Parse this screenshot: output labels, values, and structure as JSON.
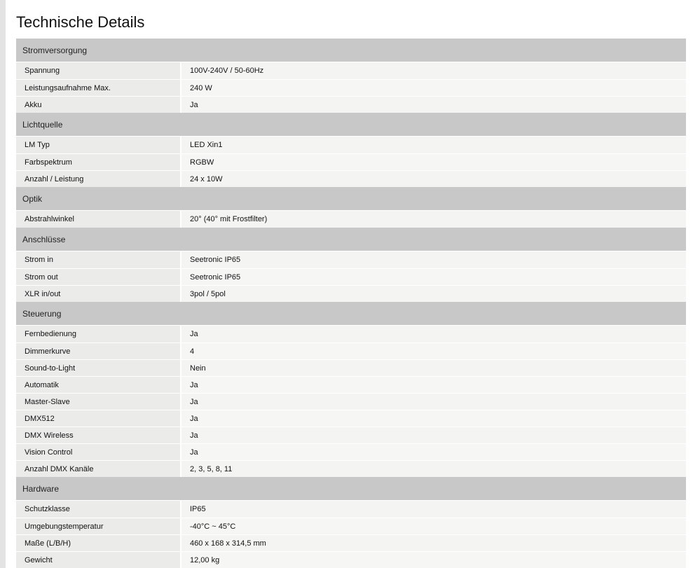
{
  "page": {
    "title": "Technische Details"
  },
  "sections": [
    {
      "header": "Stromversorgung",
      "rows": [
        {
          "label": "Spannung",
          "value": "100V-240V / 50-60Hz"
        },
        {
          "label": "Leistungsaufnahme Max.",
          "value": "240 W"
        },
        {
          "label": "Akku",
          "value": "Ja"
        }
      ]
    },
    {
      "header": "Lichtquelle",
      "rows": [
        {
          "label": "LM Typ",
          "value": "LED Xin1"
        },
        {
          "label": "Farbspektrum",
          "value": "RGBW"
        },
        {
          "label": "Anzahl / Leistung",
          "value": "24 x 10W"
        }
      ]
    },
    {
      "header": "Optik",
      "rows": [
        {
          "label": "Abstrahlwinkel",
          "value": "20° (40° mit Frostfilter)"
        }
      ]
    },
    {
      "header": "Anschlüsse",
      "rows": [
        {
          "label": "Strom in",
          "value": "Seetronic IP65"
        },
        {
          "label": "Strom out",
          "value": "Seetronic IP65"
        },
        {
          "label": "XLR in/out",
          "value": "3pol / 5pol"
        }
      ]
    },
    {
      "header": "Steuerung",
      "rows": [
        {
          "label": "Fernbedienung",
          "value": "Ja"
        },
        {
          "label": "Dimmerkurve",
          "value": "4"
        },
        {
          "label": "Sound-to-Light",
          "value": "Nein"
        },
        {
          "label": "Automatik",
          "value": "Ja"
        },
        {
          "label": "Master-Slave",
          "value": "Ja"
        },
        {
          "label": "DMX512",
          "value": "Ja"
        },
        {
          "label": "DMX Wireless",
          "value": "Ja"
        },
        {
          "label": "Vision Control",
          "value": "Ja"
        },
        {
          "label": "Anzahl DMX Kanäle",
          "value": "2, 3, 5, 8, 11"
        }
      ]
    },
    {
      "header": "Hardware",
      "rows": [
        {
          "label": "Schutzklasse",
          "value": "IP65"
        },
        {
          "label": "Umgebungstemperatur",
          "value": "-40°C ~ 45°C"
        },
        {
          "label": "Maße (L/B/H)",
          "value": "460 x 168 x 314,5 mm"
        },
        {
          "label": "Gewicht",
          "value": "12,00 kg"
        }
      ]
    }
  ]
}
